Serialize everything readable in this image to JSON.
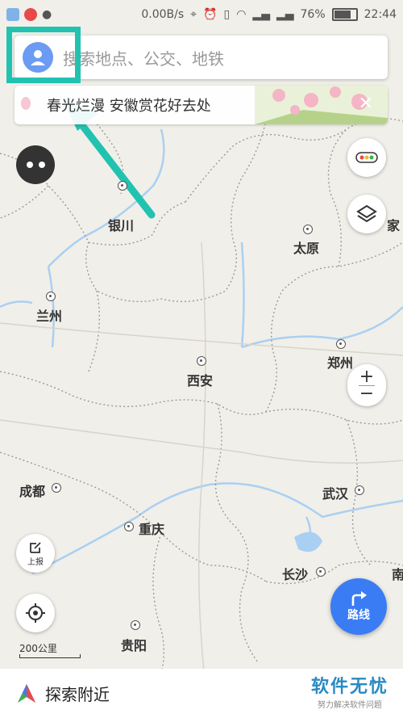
{
  "status_bar": {
    "speed": "0.00B/s",
    "battery": "76%",
    "time": "22:44"
  },
  "search": {
    "placeholder": "搜索地点、公交、地铁"
  },
  "banner": {
    "text": "春光烂漫 安徽赏花好去处"
  },
  "map": {
    "cities": [
      {
        "name": "银川"
      },
      {
        "name": "太原"
      },
      {
        "name": "兰州"
      },
      {
        "name": "郑州"
      },
      {
        "name": "西安"
      },
      {
        "name": "成都"
      },
      {
        "name": "武汉"
      },
      {
        "name": "重庆"
      },
      {
        "name": "长沙"
      },
      {
        "name": "贵阳"
      }
    ],
    "partial_labels": [
      "家",
      "南"
    ],
    "scale": "200公里"
  },
  "controls": {
    "report_label": "上报",
    "route_label": "路线"
  },
  "bottom": {
    "nearby_label": "探索附近"
  },
  "watermark": {
    "main": "软件无忧",
    "sub": "努力解决软件问题"
  },
  "colors": {
    "accent_blue": "#3a7cf4",
    "highlight_teal": "#22c2b1",
    "map_bg": "#f1efe9",
    "river_blue": "#a9d0f2"
  }
}
